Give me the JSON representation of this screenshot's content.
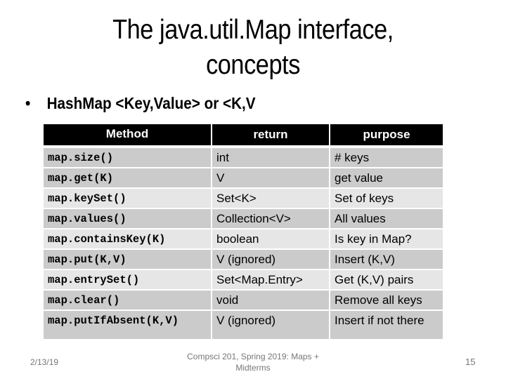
{
  "slide": {
    "title_lines": [
      "The java.util.Map interface,",
      "concepts"
    ],
    "bullet": {
      "symbol": "•",
      "text": "HashMap <Key,Value> or <K,V"
    },
    "table": {
      "headers": [
        "Method",
        "return",
        "purpose"
      ],
      "rows": [
        {
          "method": "map.size()",
          "return": "int",
          "purpose": "# keys",
          "shade": "dark"
        },
        {
          "method": "map.get(K)",
          "return": "V",
          "purpose": "get value",
          "shade": "dark"
        },
        {
          "method": "map.keySet()",
          "return": "Set<K>",
          "purpose": "Set of keys",
          "shade": "light"
        },
        {
          "method": "map.values()",
          "return": "Collection<V>",
          "purpose": "All values",
          "shade": "dark"
        },
        {
          "method": "map.containsKey(K)",
          "return": "boolean",
          "purpose": "Is key in Map?",
          "shade": "light"
        },
        {
          "method": "map.put(K,V)",
          "return": "V (ignored)",
          "purpose": "Insert (K,V)",
          "shade": "dark"
        },
        {
          "method": "map.entrySet()",
          "return": "Set<Map.Entry>",
          "purpose": "Get (K,V) pairs",
          "shade": "light"
        },
        {
          "method": "map.clear()",
          "return": "void",
          "purpose": "Remove all keys",
          "shade": "dark"
        },
        {
          "method": "map.putIfAbsent(K,V)",
          "return": "V (ignored)",
          "purpose": "Insert if not there",
          "shade": "dark"
        }
      ]
    },
    "footer": {
      "date": "2/13/19",
      "center_lines": [
        "Compsci 201, Spring 2019:  Maps +",
        "Midterms"
      ],
      "page_number": "15"
    },
    "colors": {
      "header_bg": "#000000",
      "header_text": "#ffffff",
      "row_dark": "#cbcbcb",
      "row_light": "#e6e6e6",
      "footer_text": "#777777"
    }
  }
}
